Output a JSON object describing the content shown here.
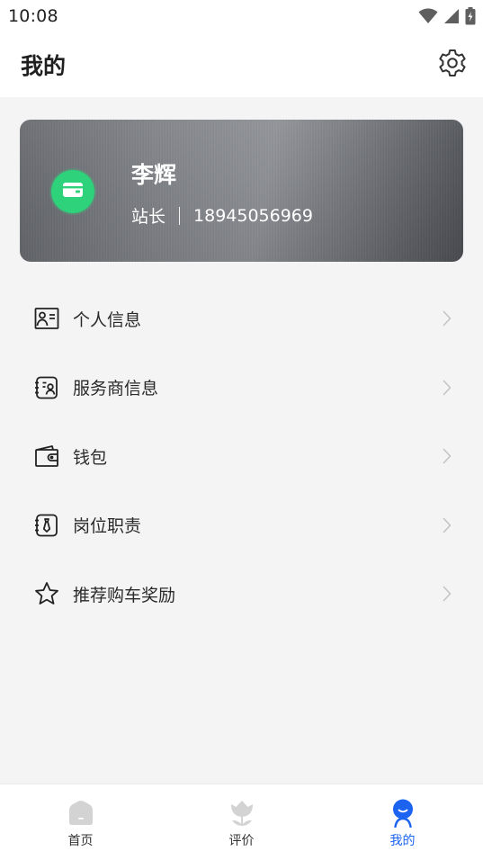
{
  "status_bar": {
    "time": "10:08"
  },
  "header": {
    "title": "我的"
  },
  "profile": {
    "name": "李辉",
    "role": "站长",
    "phone": "18945056969"
  },
  "menu": {
    "items": [
      {
        "label": "个人信息",
        "icon": "id-card-icon"
      },
      {
        "label": "服务商信息",
        "icon": "provider-profile-icon"
      },
      {
        "label": "钱包",
        "icon": "wallet-icon"
      },
      {
        "label": "岗位职责",
        "icon": "job-duty-icon"
      },
      {
        "label": "推荐购车奖励",
        "icon": "star-icon"
      }
    ]
  },
  "tabbar": {
    "items": [
      {
        "label": "首页",
        "icon": "home-icon",
        "active": false
      },
      {
        "label": "评价",
        "icon": "tulip-icon",
        "active": false
      },
      {
        "label": "我的",
        "icon": "user-icon",
        "active": true
      }
    ]
  },
  "colors": {
    "accent": "#1c63f2",
    "avatar_green": "#2ed27a",
    "background": "#f4f4f4",
    "inactive_icon": "#d3d3d3"
  }
}
